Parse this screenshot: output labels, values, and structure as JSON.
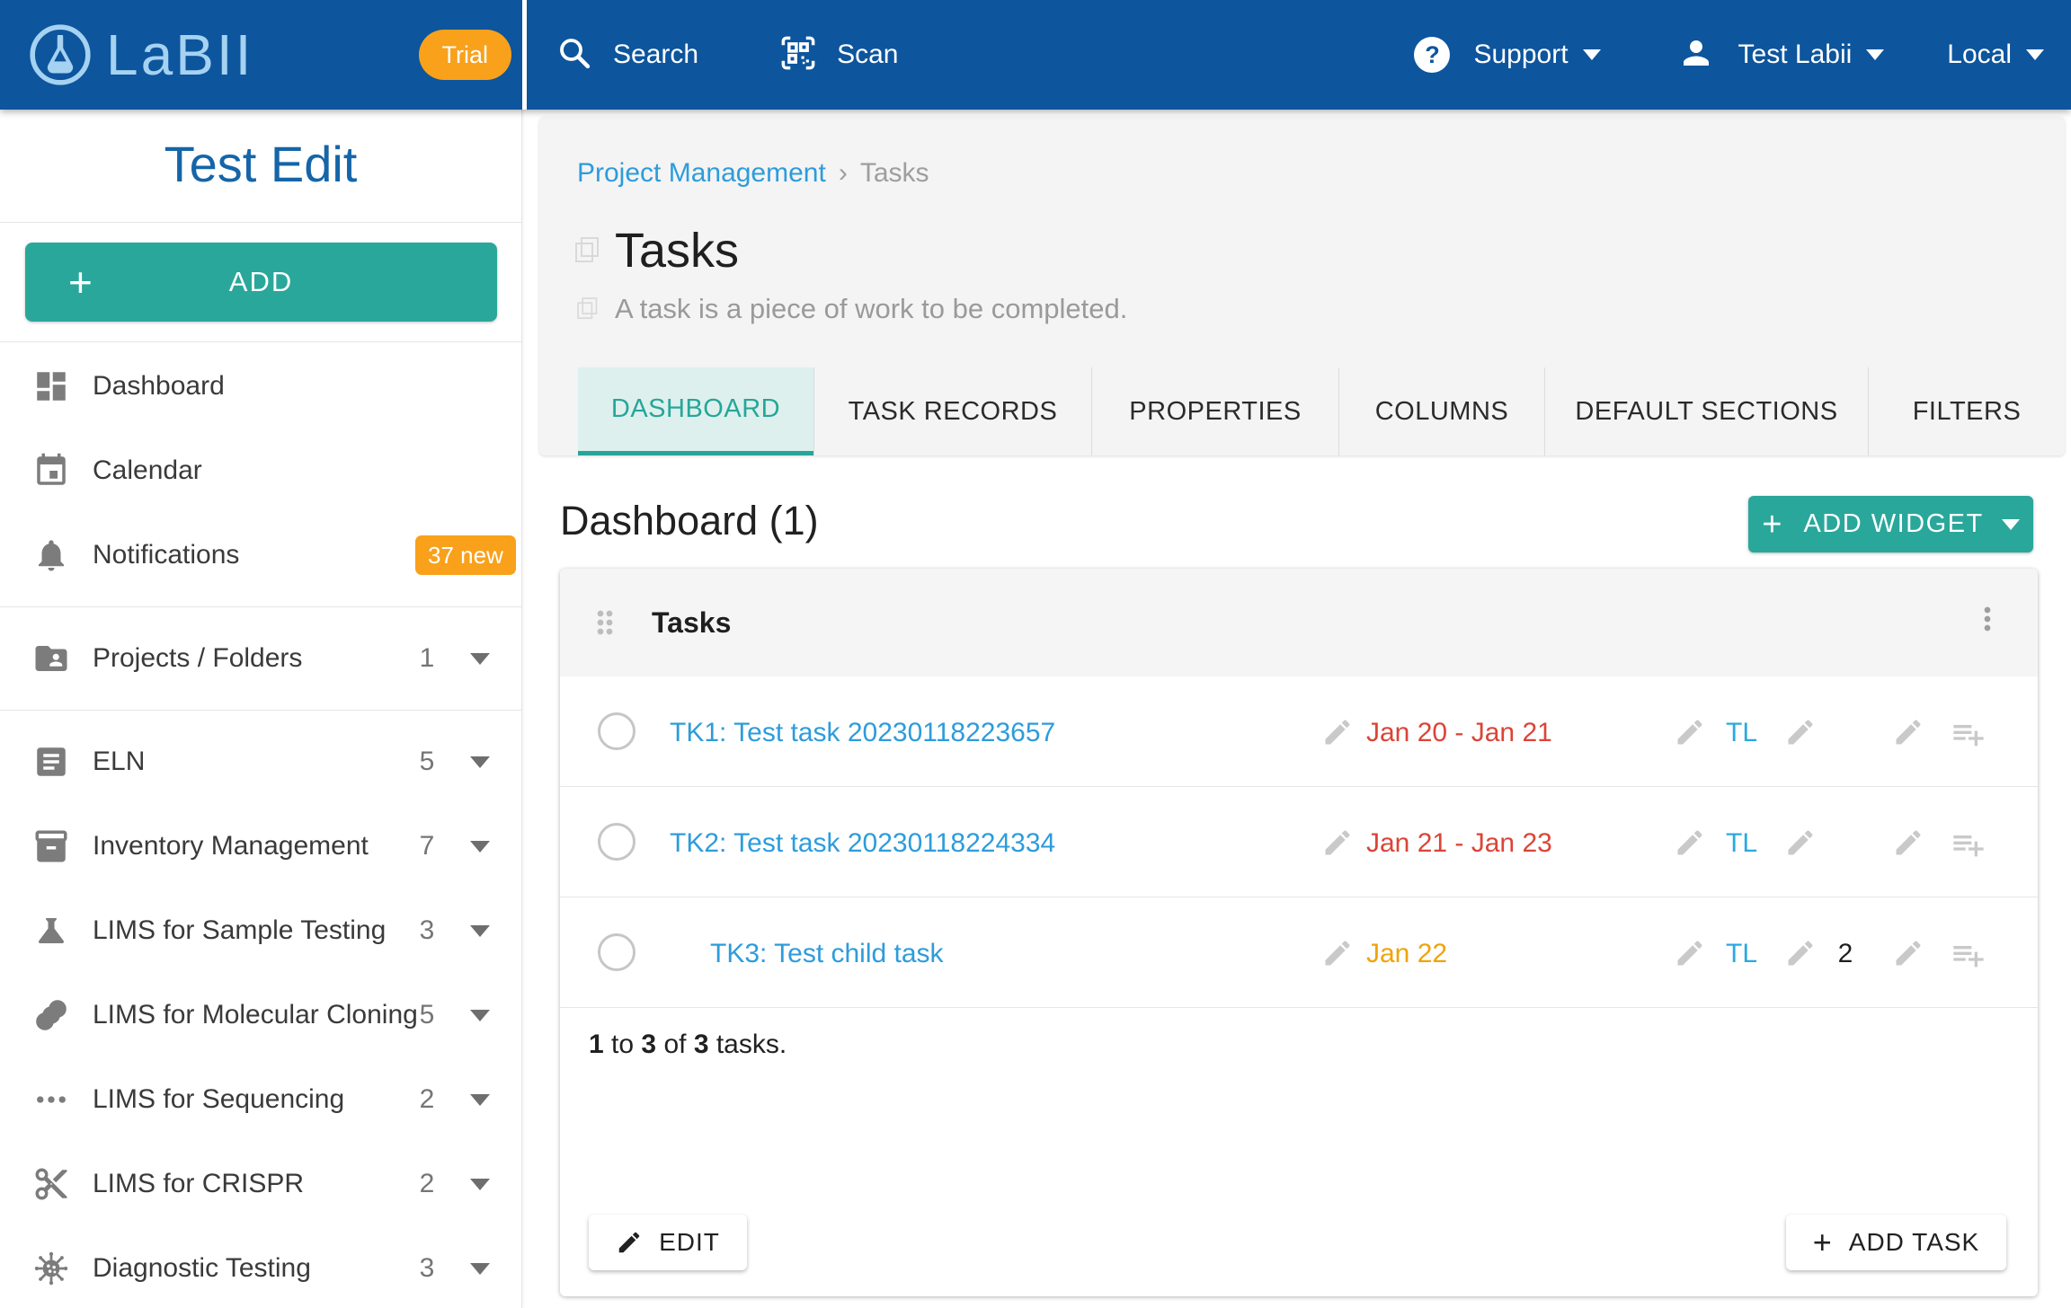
{
  "header": {
    "logo_text": "LaBII",
    "trial_badge": "Trial",
    "search_label": "Search",
    "scan_label": "Scan",
    "support_label": "Support",
    "user_label": "Test Labii",
    "env_label": "Local"
  },
  "sidebar": {
    "title": "Test Edit",
    "add_button": "ADD",
    "items": [
      {
        "label": "Dashboard",
        "icon": "dashboard-icon"
      },
      {
        "label": "Calendar",
        "icon": "calendar-icon"
      },
      {
        "label": "Notifications",
        "icon": "bell-icon",
        "badge": "37 new"
      },
      {
        "label": "Projects / Folders",
        "icon": "folder-shared-icon",
        "count": "1"
      },
      {
        "label": "ELN",
        "icon": "document-icon",
        "count": "5"
      },
      {
        "label": "Inventory Management",
        "icon": "archive-box-icon",
        "count": "7"
      },
      {
        "label": "LIMS for Sample Testing",
        "icon": "flask-icon",
        "count": "3"
      },
      {
        "label": "LIMS for Molecular Cloning",
        "icon": "rings-icon",
        "count": "5"
      },
      {
        "label": "LIMS for Sequencing",
        "icon": "dots-icon",
        "count": "2"
      },
      {
        "label": "LIMS for CRISPR",
        "icon": "scissors-icon",
        "count": "2"
      },
      {
        "label": "Diagnostic Testing",
        "icon": "virus-icon",
        "count": "3"
      }
    ]
  },
  "breadcrumb": {
    "parent": "Project Management",
    "separator": "›",
    "current": "Tasks"
  },
  "page": {
    "title": "Tasks",
    "subtitle": "A task is a piece of work to be completed."
  },
  "tabs": [
    {
      "label": "DASHBOARD",
      "active": true
    },
    {
      "label": "TASK RECORDS",
      "active": false
    },
    {
      "label": "PROPERTIES",
      "active": false
    },
    {
      "label": "COLUMNS",
      "active": false
    },
    {
      "label": "DEFAULT SECTIONS",
      "active": false
    },
    {
      "label": "FILTERS",
      "active": false
    }
  ],
  "dashboard": {
    "heading": "Dashboard (1)",
    "add_widget_button": "ADD WIDGET"
  },
  "widget": {
    "title": "Tasks",
    "rows": [
      {
        "title": "TK1: Test task 20230118223657",
        "date": "Jan 20 - Jan 21",
        "date_color": "#DB4437",
        "assignee": "TL",
        "count": "",
        "indent": false
      },
      {
        "title": "TK2: Test task 20230118224334",
        "date": "Jan 21 - Jan 23",
        "date_color": "#DB4437",
        "assignee": "TL",
        "count": "",
        "indent": false
      },
      {
        "title": "TK3: Test child task",
        "date": "Jan 22",
        "date_color": "#F0A30A",
        "assignee": "TL",
        "count": "2",
        "indent": true
      }
    ],
    "summary": {
      "n1": "1",
      "w1": "to",
      "n2": "3",
      "w2": "of",
      "n3": "3",
      "suffix": "tasks."
    },
    "edit_button": "EDIT",
    "add_task_button": "ADD TASK"
  },
  "colors": {
    "header_blue": "#0D559D",
    "logo_light_blue": "#A5D2F1",
    "accent_teal": "#2AA79B",
    "active_tab_teal": "#26A69A",
    "orange_badge": "#F9A11B",
    "link_blue": "#2D9CDB",
    "date_red": "#DB4437",
    "date_amber": "#F0A30A",
    "assignee_blue": "#29A9E1",
    "gray_card": "#F4F4F4"
  },
  "icons": [
    "flask-logo-icon",
    "search-icon",
    "qr-scan-icon",
    "help-icon",
    "person-icon",
    "chevron-down-icon",
    "dashboard-icon",
    "calendar-icon",
    "bell-icon",
    "folder-shared-icon",
    "document-icon",
    "archive-box-icon",
    "flask-icon",
    "rings-icon",
    "dots-icon",
    "scissors-icon",
    "virus-icon",
    "drag-handle-icon",
    "kebab-menu-icon",
    "pencil-icon",
    "playlist-add-icon",
    "radio-icon",
    "copy-icon",
    "plus-icon"
  ]
}
